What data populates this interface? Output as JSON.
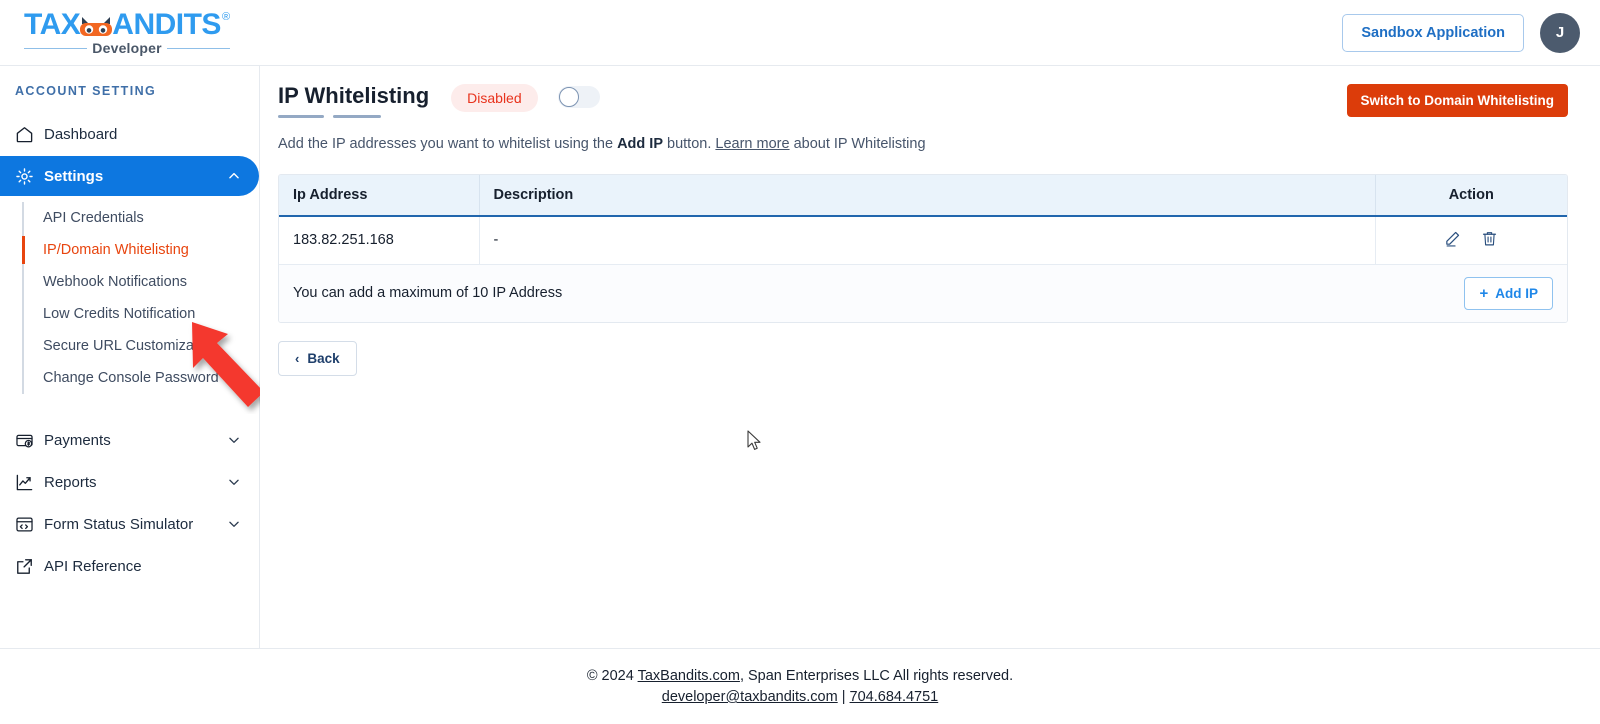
{
  "header": {
    "logo": {
      "text_left": "TAX",
      "icon": "bandit-mask-icon",
      "text_right": "ANDITS",
      "registered_mark": "®",
      "subtitle": "Developer"
    },
    "sandbox_button": "Sandbox Application",
    "avatar_initial": "J"
  },
  "sidebar": {
    "section_label": "ACCOUNT SETTING",
    "items": [
      {
        "label": "Dashboard",
        "icon": "home-icon",
        "active": false,
        "expandable": false
      },
      {
        "label": "Settings",
        "icon": "gear-icon",
        "active": true,
        "expandable": true,
        "chevron": "chevron-up-icon"
      },
      {
        "label": "Payments",
        "icon": "card-dollar-icon",
        "active": false,
        "expandable": true,
        "chevron": "chevron-down-icon"
      },
      {
        "label": "Reports",
        "icon": "chart-trend-icon",
        "active": false,
        "expandable": true,
        "chevron": "chevron-down-icon"
      },
      {
        "label": "Form Status Simulator",
        "icon": "browser-code-icon",
        "active": false,
        "expandable": true,
        "chevron": "chevron-down-icon"
      },
      {
        "label": "API Reference",
        "icon": "external-link-icon",
        "active": false,
        "expandable": false
      }
    ],
    "submenu": [
      {
        "label": "API Credentials",
        "active": false
      },
      {
        "label": "IP/Domain Whitelisting",
        "active": true
      },
      {
        "label": "Webhook Notifications",
        "active": false
      },
      {
        "label": "Low Credits Notification",
        "active": false
      },
      {
        "label": "Secure URL Customization",
        "active": false
      },
      {
        "label": "Change Console Password",
        "active": false
      }
    ]
  },
  "main": {
    "title": "IP Whitelisting",
    "status_badge": "Disabled",
    "toggle_state": "off",
    "switch_button": "Switch to Domain Whitelisting",
    "description": {
      "part1": "Add the IP addresses you want to whitelist using the ",
      "bold": "Add IP",
      "part2": " button. ",
      "link": "Learn more",
      "part3": " about IP Whitelisting"
    },
    "table": {
      "columns": [
        "Ip Address",
        "Description",
        "Action"
      ],
      "rows": [
        {
          "ip": "183.82.251.168",
          "description": "-",
          "actions": [
            "edit-icon",
            "delete-icon"
          ]
        }
      ],
      "footer_note": "You can add a maximum of 10 IP Address",
      "add_button": "Add IP",
      "add_button_icon": "plus-icon"
    },
    "back_button": "Back",
    "back_button_icon": "chevron-left-icon"
  },
  "footer": {
    "line1_pre": "© 2024 ",
    "line1_link": "TaxBandits.com",
    "line1_post": ", Span Enterprises LLC All rights reserved.",
    "email": "developer@taxbandits.com",
    "separator": " | ",
    "phone": "704.684.4751"
  },
  "annotations": {
    "arrow": "red-arrow-pointing-to-ip-domain-whitelisting",
    "cursor": "mouse-pointer"
  },
  "colors": {
    "brand_blue": "#2F9BEF",
    "nav_active": "#0d77e0",
    "accent_red": "#e8450f",
    "danger_button": "#dc3c0a",
    "badge_text": "#e8321c",
    "badge_bg": "#fdeceb",
    "table_head_bg": "#eaf3fb",
    "table_head_border": "#2166ad"
  }
}
